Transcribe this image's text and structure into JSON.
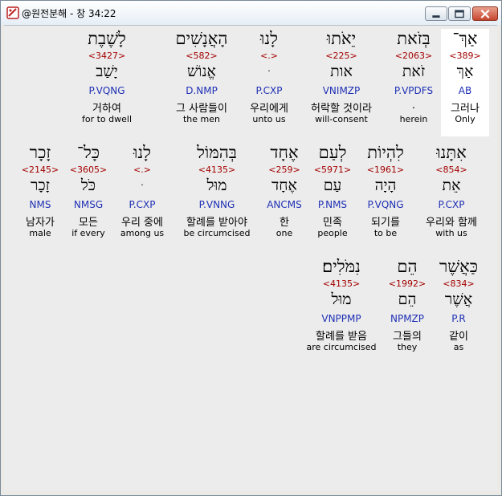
{
  "window": {
    "title": "@원전분해 - 창 34:22",
    "controls": [
      "minimize-icon",
      "maximize-icon",
      "close-icon"
    ]
  },
  "rows": [
    [
      {
        "hebrew": "אַךְ־",
        "strong": "<389>",
        "lemma": "אַךְ",
        "parsing": "AB",
        "korean": "그러나",
        "english": "Only",
        "highlight": true
      },
      {
        "hebrew": "בְּזֹאת",
        "strong": "<2063>",
        "lemma": "זֹאת",
        "parsing": "P.VPDFS",
        "korean": ".",
        "english": "herein"
      },
      {
        "hebrew": "יֵאֹתוּ",
        "strong": "<225>",
        "lemma": "אות",
        "parsing": "VNIMZP",
        "korean": "허락할 것이라",
        "english": "will-consent"
      },
      {
        "hebrew": "לָנוּ",
        "strong": "<.>",
        "lemma": "ּ",
        "parsing": "P.CXP",
        "korean": "우리에게",
        "english": "unto us"
      },
      {
        "hebrew": "הָאֲנָשִׁים",
        "strong": "<582>",
        "lemma": "אֱנוֹשׁ",
        "parsing": "D.NMP",
        "korean": "그 사람들이",
        "english": "the men"
      },
      {
        "hebrew": "לָשֶׁבֶת",
        "strong": "<3427>",
        "lemma": "יָשַׁב",
        "parsing": "P.VQNG",
        "korean": "거하여",
        "english": "for to dwell"
      }
    ],
    [
      {
        "hebrew": "אִתָּנוּ",
        "strong": "<854>",
        "lemma": "אֵת",
        "parsing": "P.CXP",
        "korean": "우리와 함께",
        "english": "with us"
      },
      {
        "hebrew": "לִהְיוֹת",
        "strong": "<1961>",
        "lemma": "הָיָה",
        "parsing": "P.VQNG",
        "korean": "되기를",
        "english": "to be"
      },
      {
        "hebrew": "לְעַם",
        "strong": "<5971>",
        "lemma": "עַם",
        "parsing": "P.NMS",
        "korean": "민족",
        "english": "people"
      },
      {
        "hebrew": "אֶחָד",
        "strong": "<259>",
        "lemma": "אֶחָד",
        "parsing": "ANCMS",
        "korean": "한",
        "english": "one"
      },
      {
        "hebrew": "בְּהִמּוֹל",
        "strong": "<4135>",
        "lemma": "מוּל",
        "parsing": "P.VNNG",
        "korean": "할례를 받아야",
        "english": "be circumcised"
      },
      {
        "hebrew": "לָנוּ",
        "strong": "<.>",
        "lemma": "ּ",
        "parsing": "P.CXP",
        "korean": "우리 중에",
        "english": "among us"
      },
      {
        "hebrew": "כָּל־",
        "strong": "<3605>",
        "lemma": "כֹּל",
        "parsing": "NMSG",
        "korean": "모든",
        "english": "if every"
      },
      {
        "hebrew": "זָכָר",
        "strong": "<2145>",
        "lemma": "זָכָר",
        "parsing": "NMS",
        "korean": "남자가",
        "english": "male"
      }
    ],
    [
      {
        "hebrew": "כַּאֲשֶׁר",
        "strong": "<834>",
        "lemma": "אֲשֶׁר",
        "parsing": "P.R",
        "korean": "같이",
        "english": "as"
      },
      {
        "hebrew": "הֵם",
        "strong": "<1992>",
        "lemma": "הֵם",
        "parsing": "NPMZP",
        "korean": "그들의",
        "english": "they"
      },
      {
        "hebrew": "נִמֹּלִים׃",
        "strong": "<4135>",
        "lemma": "מוּל",
        "parsing": "VNPPMP",
        "korean": "할례를 받음",
        "english": "are circumcised"
      }
    ]
  ]
}
